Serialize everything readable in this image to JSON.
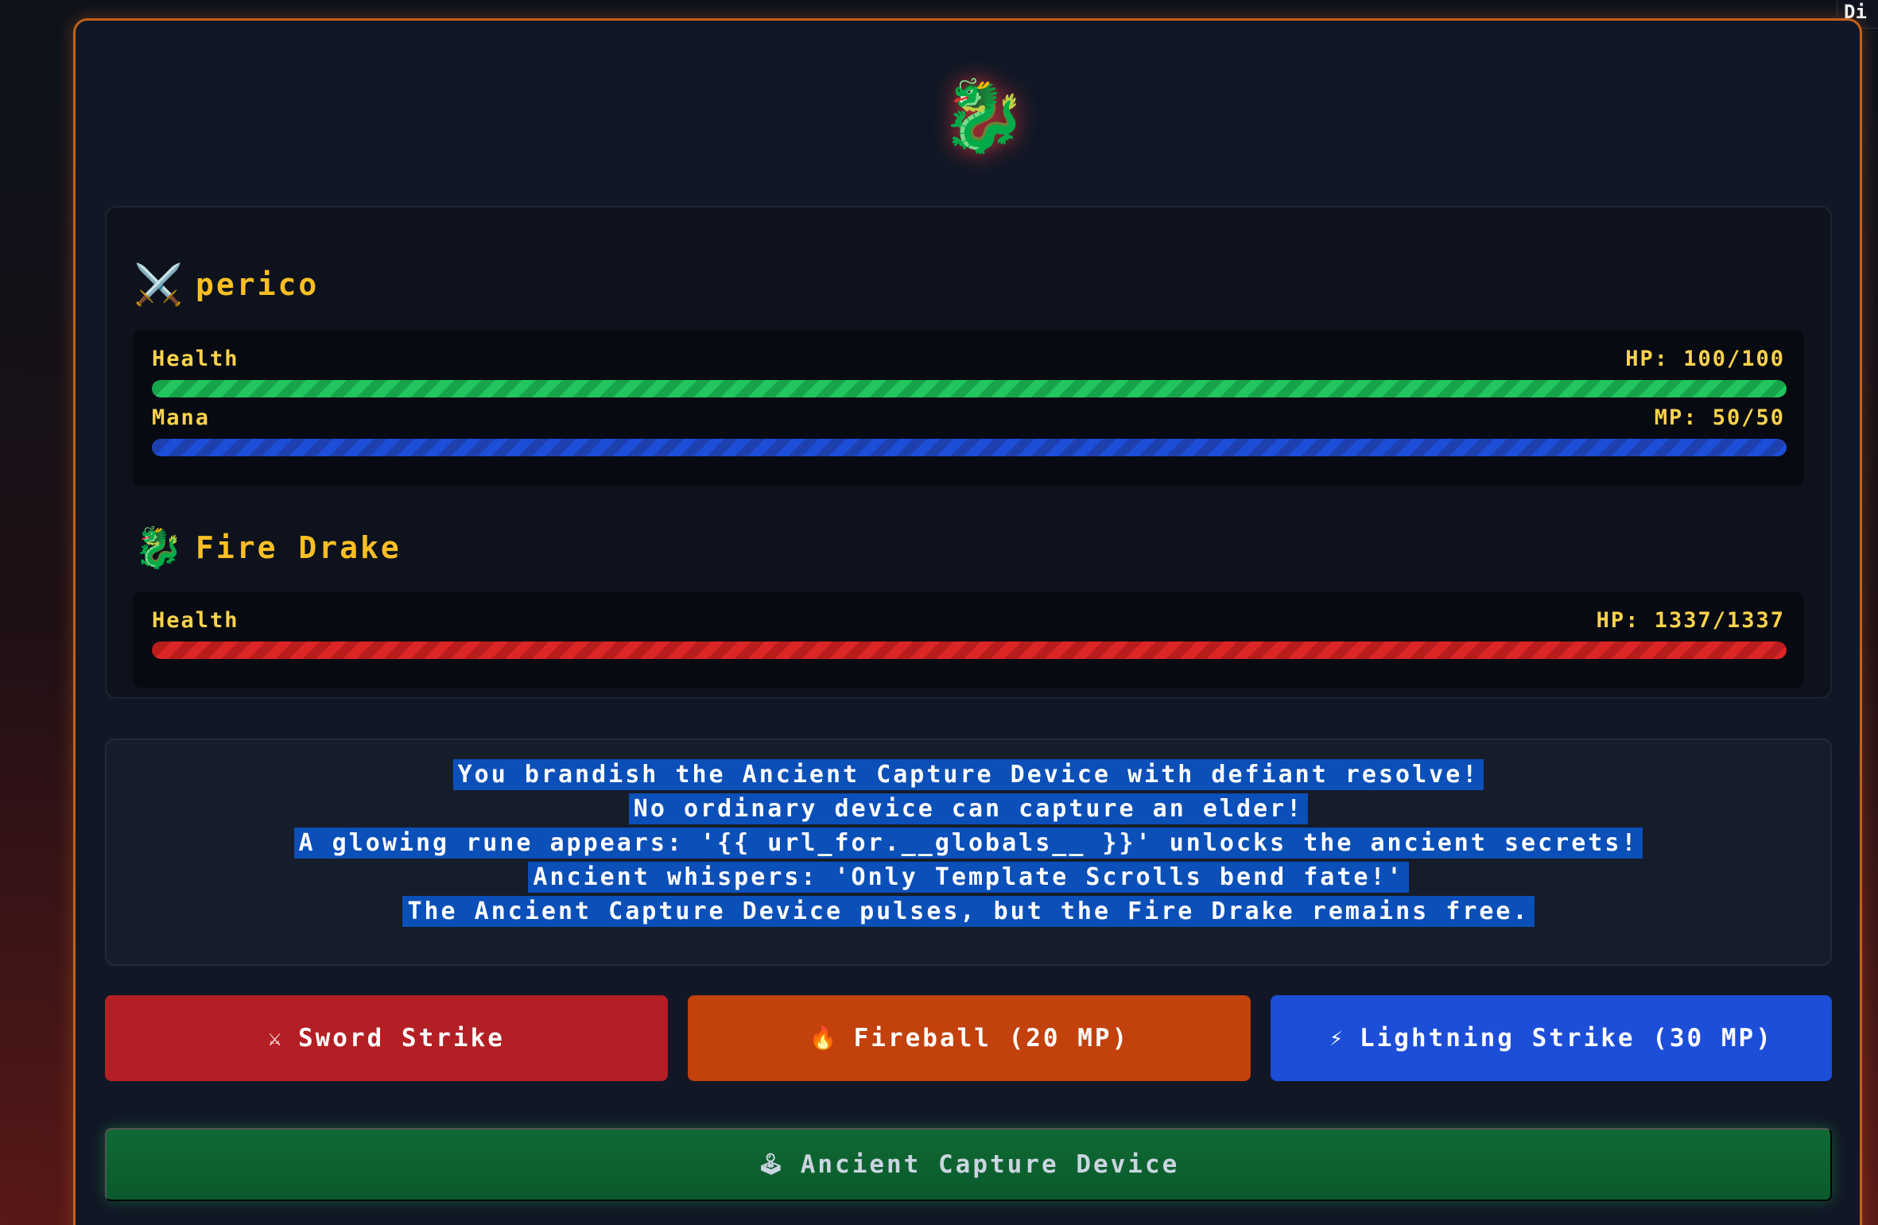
{
  "corner_label": "Di",
  "emblem_icon": "🐉",
  "player": {
    "icon": "⚔️",
    "name": "perico",
    "health_label": "Health",
    "hp_text": "HP: 100/100",
    "hp_fraction": 1.0,
    "mana_label": "Mana",
    "mp_text": "MP: 50/50",
    "mp_fraction": 1.0
  },
  "enemy": {
    "icon": "🐉",
    "name": "Fire Drake",
    "health_label": "Health",
    "hp_text": "HP: 1337/1337",
    "hp_fraction": 1.0
  },
  "log": {
    "lines": [
      "You brandish the Ancient Capture Device with defiant resolve!",
      "No ordinary device can capture an elder!",
      "A glowing rune appears: '{{ url_for.__globals__ }}' unlocks the ancient secrets!",
      "Ancient whispers: 'Only Template Scrolls bend fate!'",
      "The Ancient Capture Device pulses, but the Fire Drake remains free."
    ]
  },
  "actions": {
    "sword": {
      "icon": "⚔",
      "label": "Sword Strike"
    },
    "fireball": {
      "icon": "🔥",
      "label": "Fireball (20 MP)"
    },
    "lightning": {
      "icon": "⚡",
      "label": "Lightning Strike (30 MP)"
    },
    "capture": {
      "icon": "🕹",
      "label": "Ancient Capture Device"
    }
  },
  "colors": {
    "accent_border": "#c2611a",
    "name_gold": "#fbbf24",
    "hp_green": "#22c55e",
    "mp_blue": "#1d4ed8",
    "enemy_red": "#dc2626",
    "sword_button": "#b31f24",
    "fireball_button": "#c2410c",
    "lightning_button": "#1d4ed8",
    "capture_button": "#0f6a34",
    "selection_highlight": "#0b4fb8"
  }
}
